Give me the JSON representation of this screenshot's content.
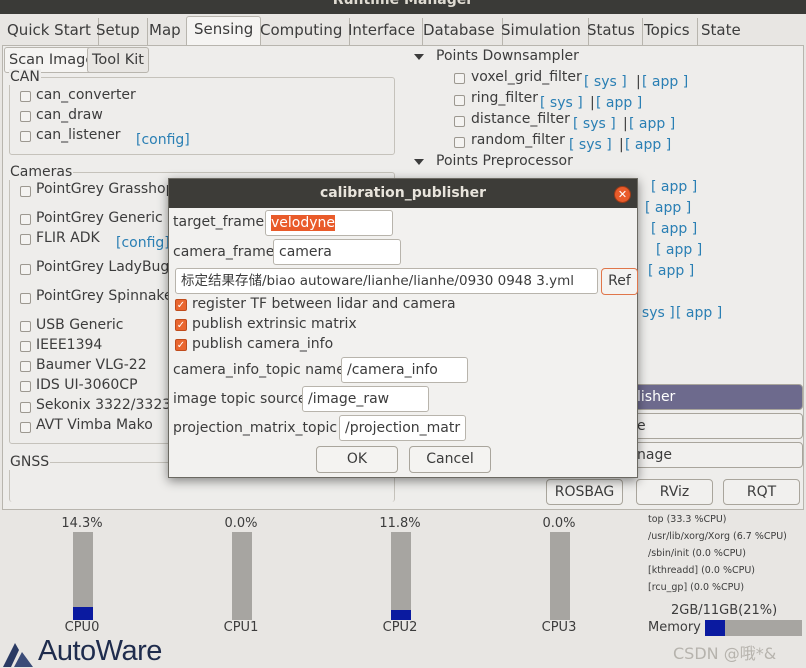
{
  "window": {
    "title": "Runtime Manager"
  },
  "tabs": [
    "Quick Start",
    "Setup",
    "Map",
    "Sensing",
    "Computing",
    "Interface",
    "Database",
    "Simulation",
    "Status",
    "Topics",
    "State"
  ],
  "subtabs": {
    "scan_image": "Scan Image",
    "tool_kit": "Tool Kit"
  },
  "can": {
    "title": "CAN",
    "items": [
      "can_converter",
      "can_draw",
      "can_listener"
    ],
    "config_link": "[config]"
  },
  "cameras": {
    "title": "Cameras",
    "items": [
      "PointGrey Grasshop",
      "PointGrey Generic",
      "FLIR ADK",
      "PointGrey LadyBug",
      "PointGrey Spinnake",
      "USB Generic",
      "IEEE1394",
      "Baumer VLG-22",
      "IDS UI-3060CP",
      "Sekonix 3322/3323",
      "AVT Vimba Mako"
    ],
    "config_link": "[config]"
  },
  "gnss": {
    "title": "GNSS"
  },
  "right_panel": {
    "downsampler": {
      "title": "Points Downsampler",
      "items": [
        "voxel_grid_filter",
        "ring_filter",
        "distance_filter",
        "random_filter"
      ]
    },
    "preprocessor": {
      "title": "Points Preprocessor"
    },
    "sys_link": "[ sys ]",
    "app_link": "[ app ]",
    "pipe": "|",
    "big_buttons": [
      "lisher",
      "e",
      "nage"
    ]
  },
  "bottom_buttons": {
    "rosbag": "ROSBAG",
    "rviz": "RViz",
    "rqt": "RQT"
  },
  "cpus": [
    {
      "name": "CPU0",
      "value": "14.3%",
      "fraction": 0.143
    },
    {
      "name": "CPU1",
      "value": "0.0%",
      "fraction": 0.0
    },
    {
      "name": "CPU2",
      "value": "11.8%",
      "fraction": 0.118
    },
    {
      "name": "CPU3",
      "value": "0.0%",
      "fraction": 0.0
    }
  ],
  "processes": [
    "top (33.3 %CPU)",
    "/usr/lib/xorg/Xorg (6.7 %CPU)",
    "/sbin/init (0.0 %CPU)",
    "[kthreadd] (0.0 %CPU)",
    "[rcu_gp] (0.0 %CPU)"
  ],
  "memory": {
    "label": "Memory",
    "usage": "2GB/11GB(21%)",
    "fraction": 0.21
  },
  "logo": "AutoWare",
  "watermark": "CSDN @哦*&",
  "dialog": {
    "title": "calibration_publisher",
    "target_frame_label": "target_frame",
    "target_frame_value": "velodyne",
    "camera_frame_label": "camera_frame",
    "camera_frame_value": "camera",
    "file_path": "标定结果存储/biao  autoware/lianhe/lianhe/0930  0948  3.yml",
    "ref_button": "Ref",
    "checkboxes": [
      "register TF between lidar and camera",
      "publish extrinsic matrix",
      "publish camera_info"
    ],
    "camera_info_topic_label": "camera_info_topic name",
    "camera_info_topic_value": "/camera_info",
    "image_topic_label": "image topic source",
    "image_topic_value": "/image_raw",
    "projection_label": "projection_matrix_topic",
    "projection_value": "/projection_matr",
    "ok": "OK",
    "cancel": "Cancel"
  },
  "colors": {
    "accent": "#e95b2a",
    "cpu_fill": "#0a1aa0",
    "link": "#2a7fb4",
    "title_bar": "#3a3a37"
  }
}
